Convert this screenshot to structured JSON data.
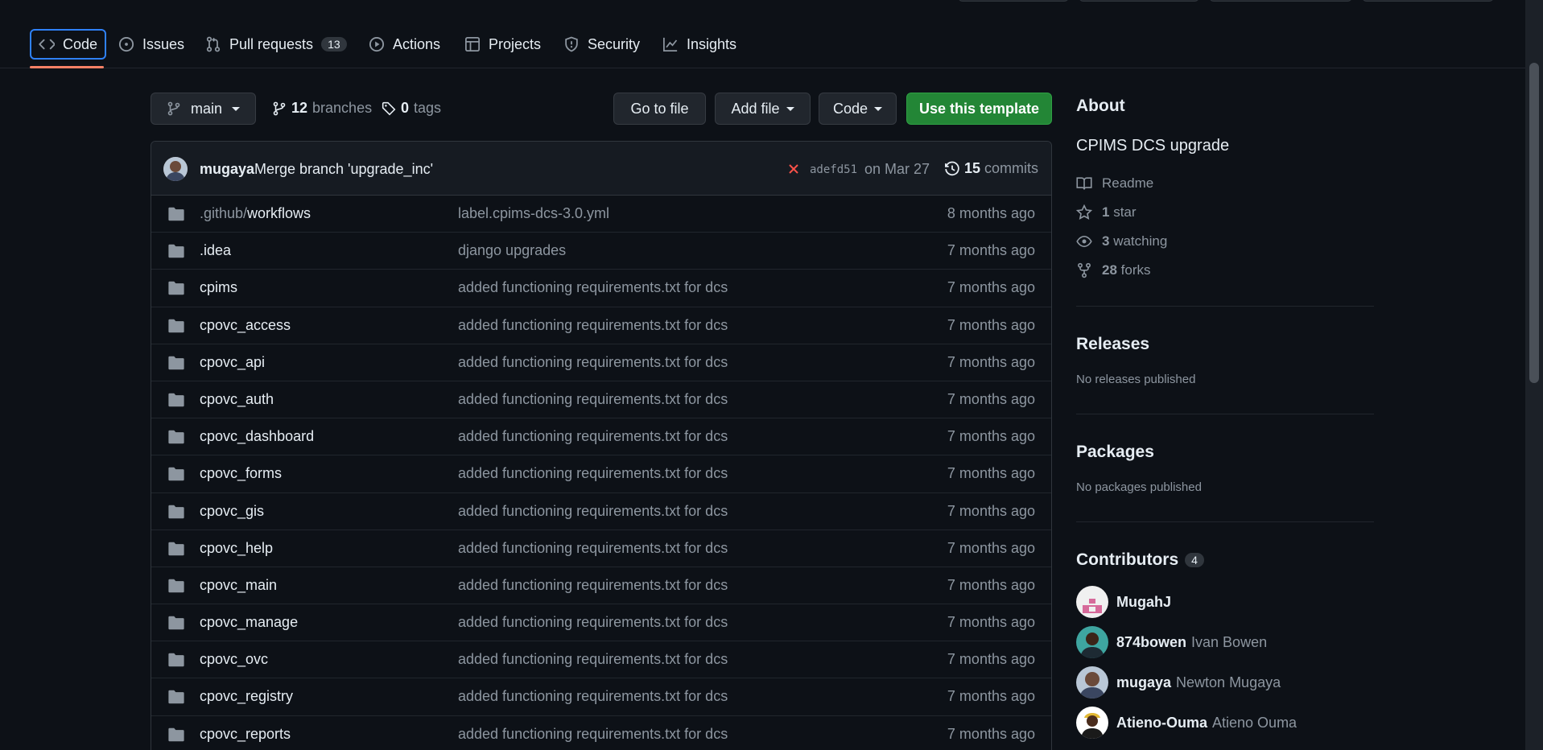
{
  "nav": {
    "tabs": [
      {
        "label": "Code",
        "icon": "code-icon"
      },
      {
        "label": "Issues",
        "icon": "issue-icon"
      },
      {
        "label": "Pull requests",
        "icon": "pull-request-icon",
        "count": "13"
      },
      {
        "label": "Actions",
        "icon": "play-icon"
      },
      {
        "label": "Projects",
        "icon": "table-icon"
      },
      {
        "label": "Security",
        "icon": "shield-icon"
      },
      {
        "label": "Insights",
        "icon": "graph-icon"
      }
    ]
  },
  "branch_bar": {
    "branch": "main",
    "branches_count": "12",
    "branches_label": "branches",
    "tags_count": "0",
    "tags_label": "tags",
    "go_to_file": "Go to file",
    "add_file": "Add file",
    "code": "Code",
    "use_template": "Use this template"
  },
  "commit": {
    "author": "mugaya",
    "message": "Merge branch 'upgrade_inc'",
    "status": "failed",
    "sha": "adefd51",
    "date": "on Mar 27",
    "commits_count": "15",
    "commits_label": "commits"
  },
  "files": [
    {
      "prefix": ".github/",
      "name": "workflows",
      "message": "label.cpims-dcs-3.0.yml",
      "age": "8 months ago"
    },
    {
      "prefix": "",
      "name": ".idea",
      "message": "django upgrades",
      "age": "7 months ago"
    },
    {
      "prefix": "",
      "name": "cpims",
      "message": "added functioning requirements.txt for dcs",
      "age": "7 months ago"
    },
    {
      "prefix": "",
      "name": "cpovc_access",
      "message": "added functioning requirements.txt for dcs",
      "age": "7 months ago"
    },
    {
      "prefix": "",
      "name": "cpovc_api",
      "message": "added functioning requirements.txt for dcs",
      "age": "7 months ago"
    },
    {
      "prefix": "",
      "name": "cpovc_auth",
      "message": "added functioning requirements.txt for dcs",
      "age": "7 months ago"
    },
    {
      "prefix": "",
      "name": "cpovc_dashboard",
      "message": "added functioning requirements.txt for dcs",
      "age": "7 months ago"
    },
    {
      "prefix": "",
      "name": "cpovc_forms",
      "message": "added functioning requirements.txt for dcs",
      "age": "7 months ago"
    },
    {
      "prefix": "",
      "name": "cpovc_gis",
      "message": "added functioning requirements.txt for dcs",
      "age": "7 months ago"
    },
    {
      "prefix": "",
      "name": "cpovc_help",
      "message": "added functioning requirements.txt for dcs",
      "age": "7 months ago"
    },
    {
      "prefix": "",
      "name": "cpovc_main",
      "message": "added functioning requirements.txt for dcs",
      "age": "7 months ago"
    },
    {
      "prefix": "",
      "name": "cpovc_manage",
      "message": "added functioning requirements.txt for dcs",
      "age": "7 months ago"
    },
    {
      "prefix": "",
      "name": "cpovc_ovc",
      "message": "added functioning requirements.txt for dcs",
      "age": "7 months ago"
    },
    {
      "prefix": "",
      "name": "cpovc_registry",
      "message": "added functioning requirements.txt for dcs",
      "age": "7 months ago"
    },
    {
      "prefix": "",
      "name": "cpovc_reports",
      "message": "added functioning requirements.txt for dcs",
      "age": "7 months ago"
    }
  ],
  "about": {
    "heading": "About",
    "description": "CPIMS DCS upgrade",
    "readme": "Readme",
    "stars_count": "1",
    "stars_label": "star",
    "watching_count": "3",
    "watching_label": "watching",
    "forks_count": "28",
    "forks_label": "forks"
  },
  "releases": {
    "heading": "Releases",
    "empty": "No releases published"
  },
  "packages": {
    "heading": "Packages",
    "empty": "No packages published"
  },
  "contributors": {
    "heading": "Contributors",
    "count": "4",
    "list": [
      {
        "login": "MugahJ",
        "name": ""
      },
      {
        "login": "874bowen",
        "name": "Ivan Bowen"
      },
      {
        "login": "mugaya",
        "name": "Newton Mugaya"
      },
      {
        "login": "Atieno-Ouma",
        "name": "Atieno Ouma"
      }
    ]
  },
  "colors": {
    "background": "#0d1117",
    "accent_blue": "#2f81f7",
    "active_underline": "#f78166",
    "primary_green": "#238636",
    "fail_red": "#f85149",
    "muted_text": "#8d96a0"
  }
}
